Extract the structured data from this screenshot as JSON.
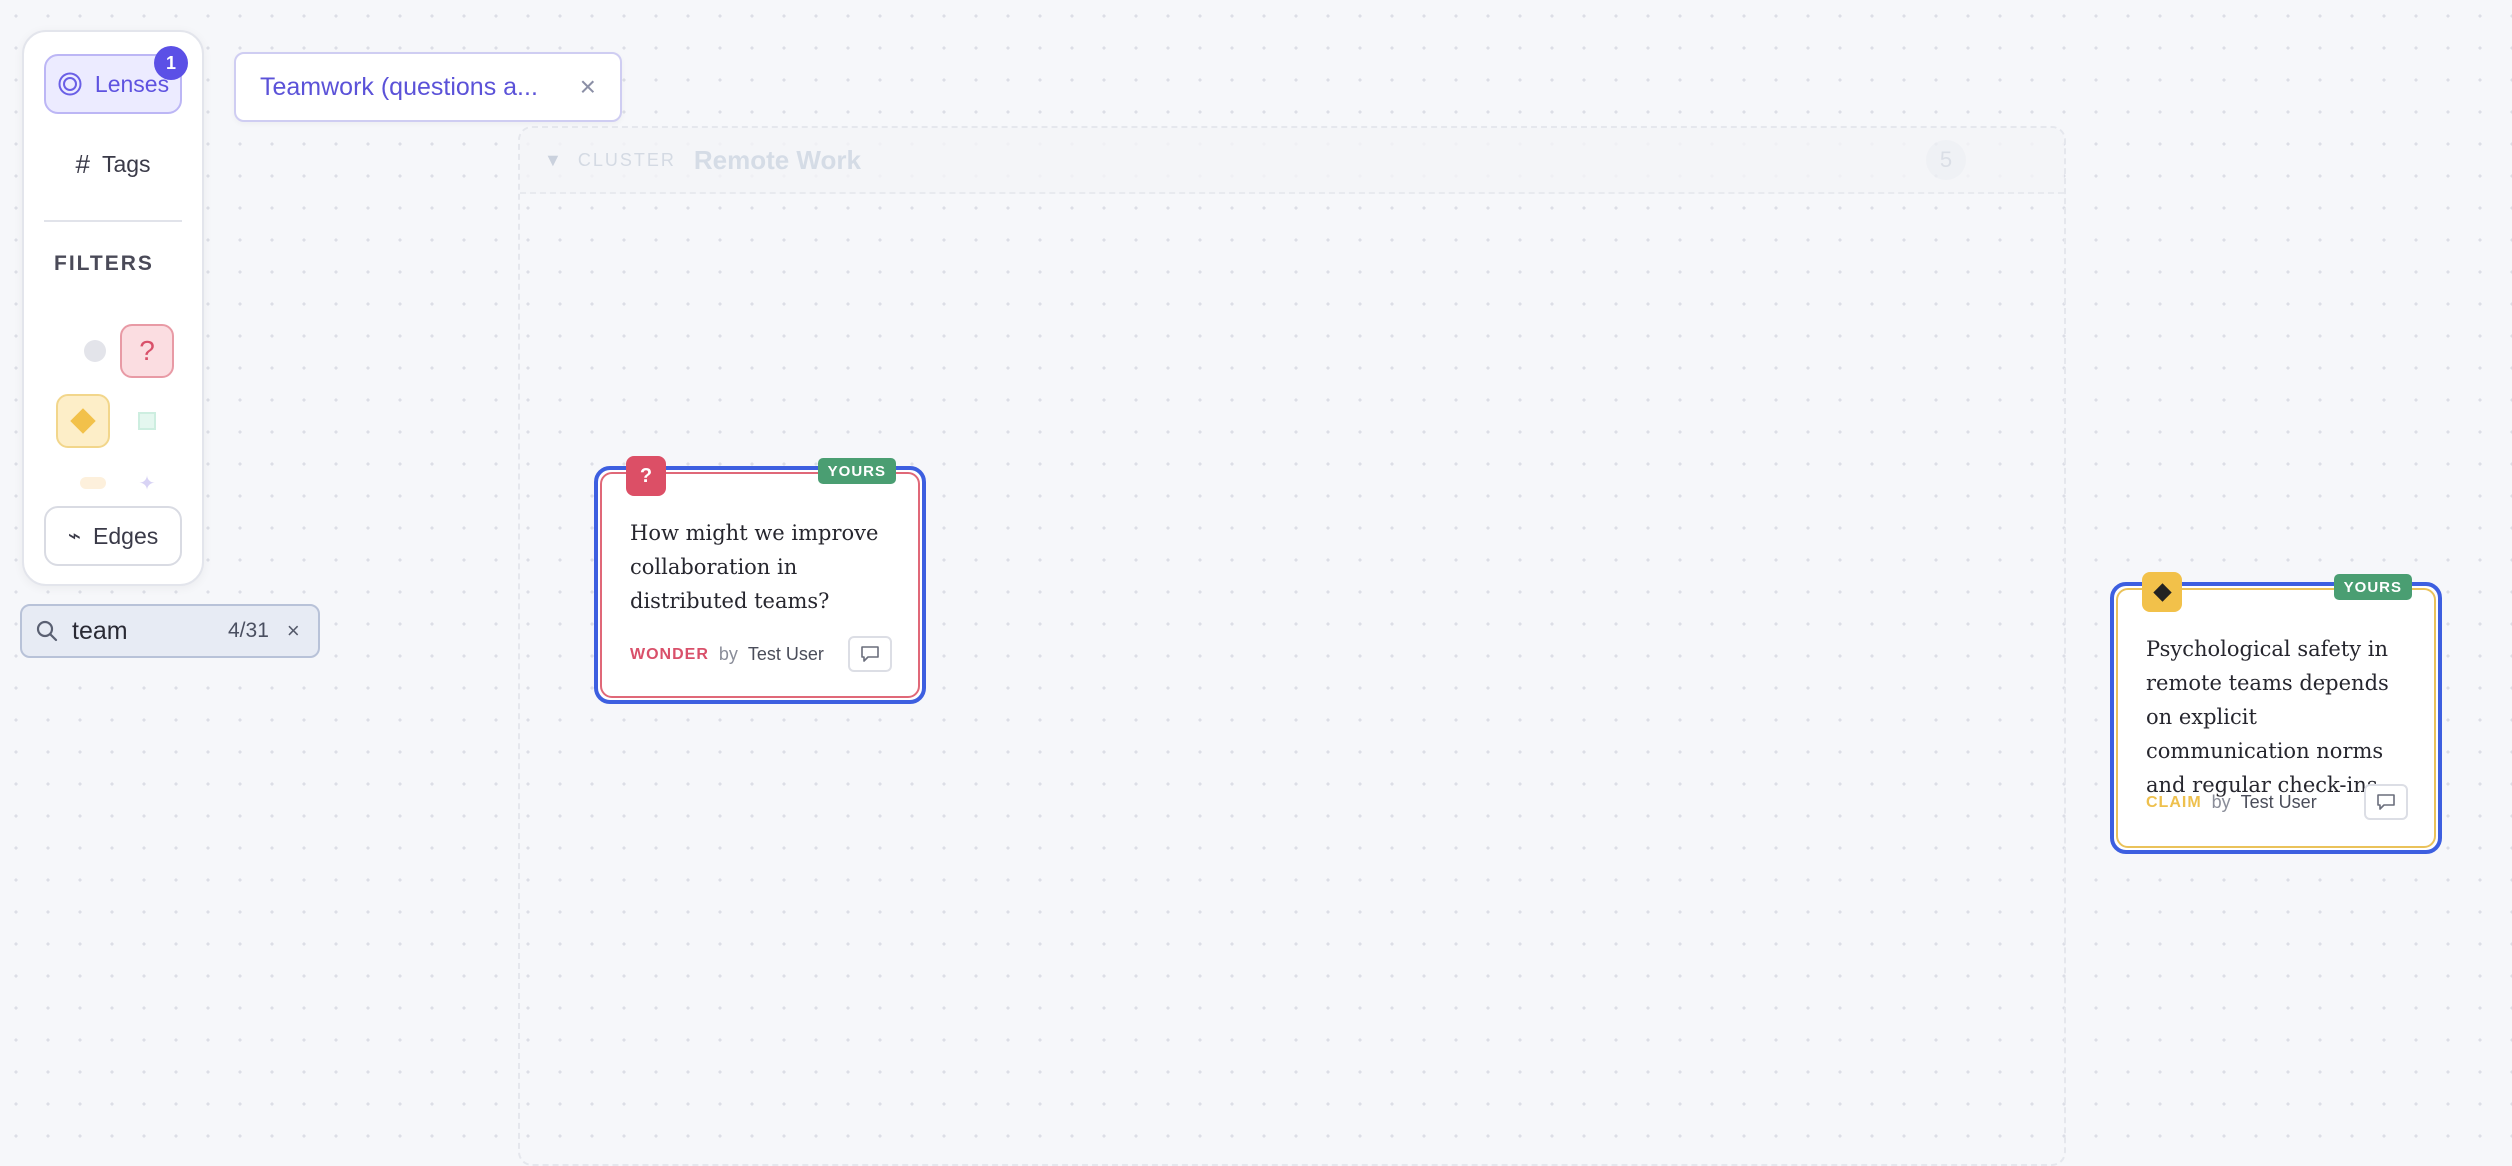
{
  "toolbar": {
    "lenses_label": "Lenses",
    "lenses_badge": "1",
    "tags_label": "Tags",
    "filters_label": "FILTERS",
    "filters": [
      {
        "name": "wonder-filter",
        "glyph": "?",
        "active": true
      },
      {
        "name": "claim-filter",
        "glyph": "◆",
        "active": true
      }
    ],
    "edges_label": "Edges"
  },
  "search": {
    "value": "team",
    "count": "4/31",
    "clear": "×"
  },
  "lens_chip": {
    "label": "Teamwork (questions a...",
    "close": "×"
  },
  "cluster": {
    "toggle": "▼",
    "tag": "CLUSTER",
    "name": "Remote Work",
    "count": "5"
  },
  "cards": [
    {
      "type_label": "WONDER",
      "icon": "?",
      "badge": "YOURS",
      "text": "How might we improve collaboration in distributed teams?",
      "by": "by",
      "author": "Test User",
      "colors": {
        "border": "#3d5fe0",
        "accent": "#dc4f66"
      }
    },
    {
      "type_label": "CLAIM",
      "icon": "◆",
      "badge": "YOURS",
      "text": "Psychological safety in remote teams depends on explicit communication norms and regular check-ins.",
      "by": "by",
      "author": "Test User",
      "colors": {
        "border": "#3d5fe0",
        "accent": "#f2c14a"
      }
    }
  ]
}
